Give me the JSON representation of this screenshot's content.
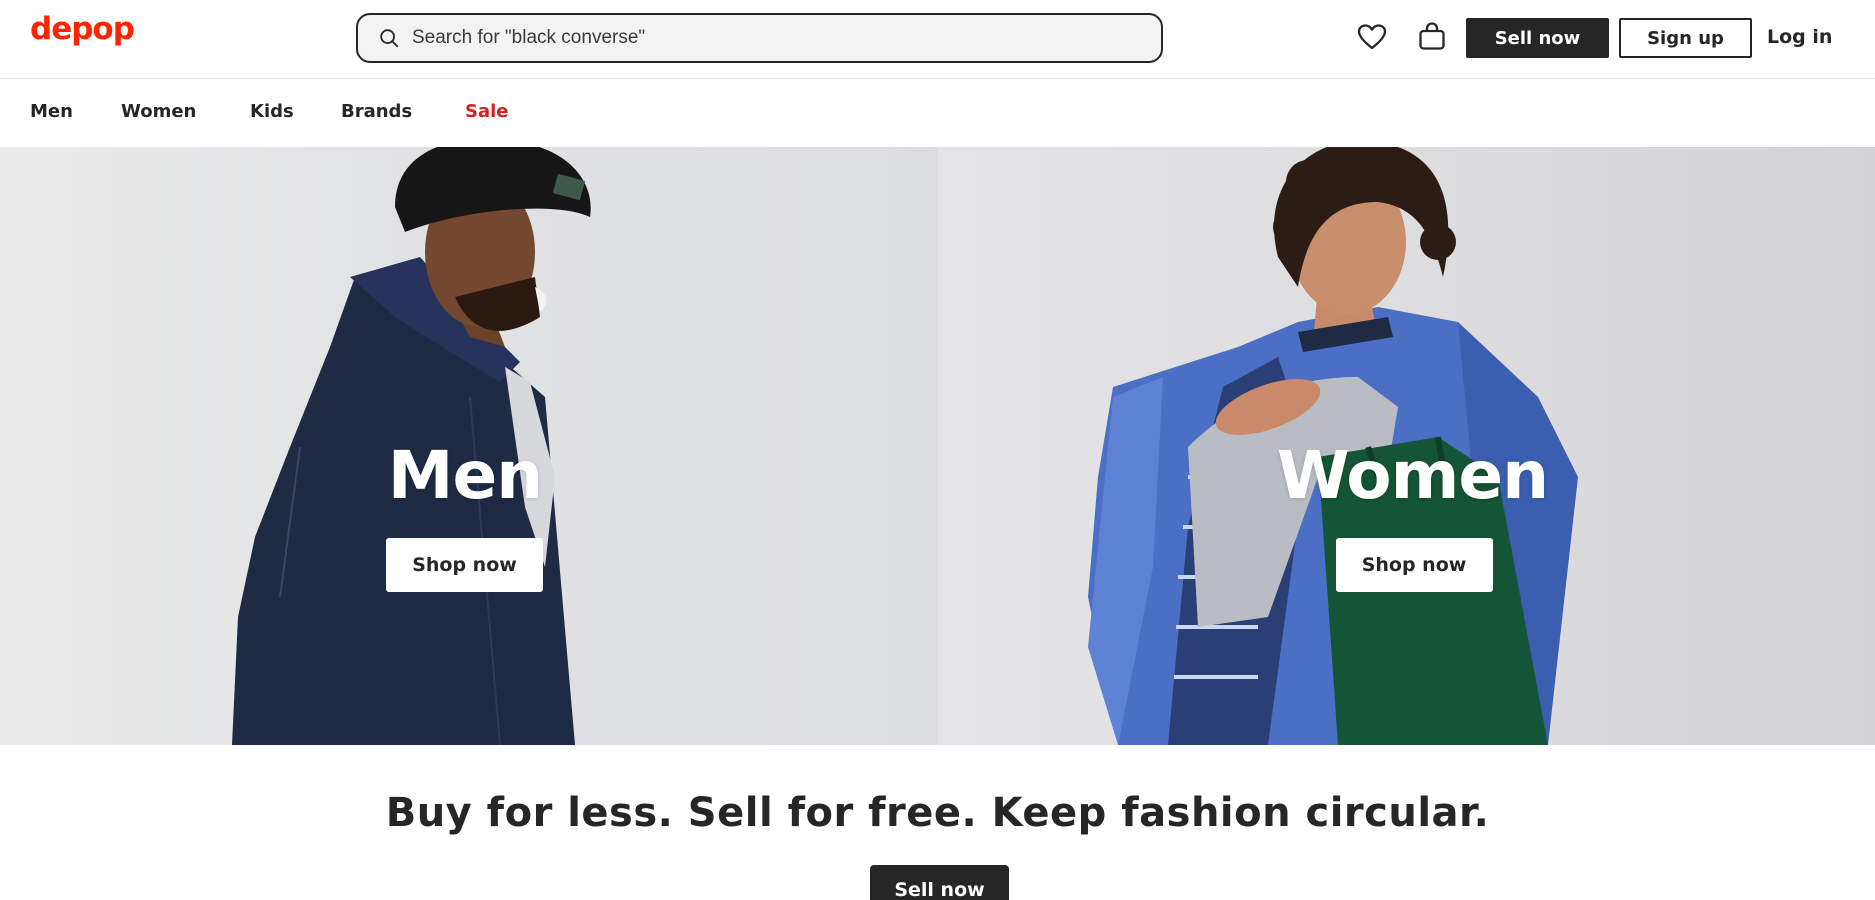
{
  "colors": {
    "brand": "#ff2300",
    "sale": "#d51f1f",
    "dark": "#262626"
  },
  "header": {
    "logo": "depop",
    "search": {
      "placeholder": "Search for \"black converse\"",
      "value": "",
      "icon": "search-icon"
    },
    "icons": [
      "heart-icon",
      "shopping-bag-icon"
    ],
    "sell_now": "Sell now",
    "sign_up": "Sign up",
    "log_in": "Log in"
  },
  "nav": {
    "items": [
      {
        "label": "Men"
      },
      {
        "label": "Women"
      },
      {
        "label": "Kids"
      },
      {
        "label": "Brands"
      },
      {
        "label": "Sale"
      }
    ]
  },
  "hero": {
    "panels": [
      {
        "title": "Men",
        "cta": "Shop now",
        "image": "man in black beanie and denim jacket smiling"
      },
      {
        "title": "Women",
        "cta": "Shop now",
        "image": "woman with curly hair in blue satin jacket carrying green tote bag"
      }
    ]
  },
  "promo": {
    "tagline": "Buy for less. Sell for free. Keep fashion circular.",
    "cta": "Sell now"
  }
}
